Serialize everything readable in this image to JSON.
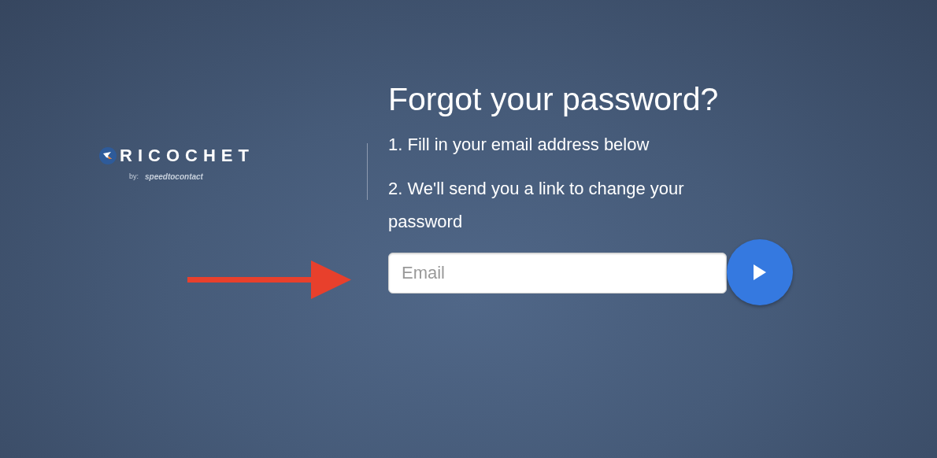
{
  "logo": {
    "name": "RICOCHET",
    "by": "by:",
    "company": "speedtocontact"
  },
  "title": "Forgot your password?",
  "steps": [
    "1. Fill in your email address below",
    "2. We'll send you a link to change your password"
  ],
  "email": {
    "placeholder": "Email"
  }
}
